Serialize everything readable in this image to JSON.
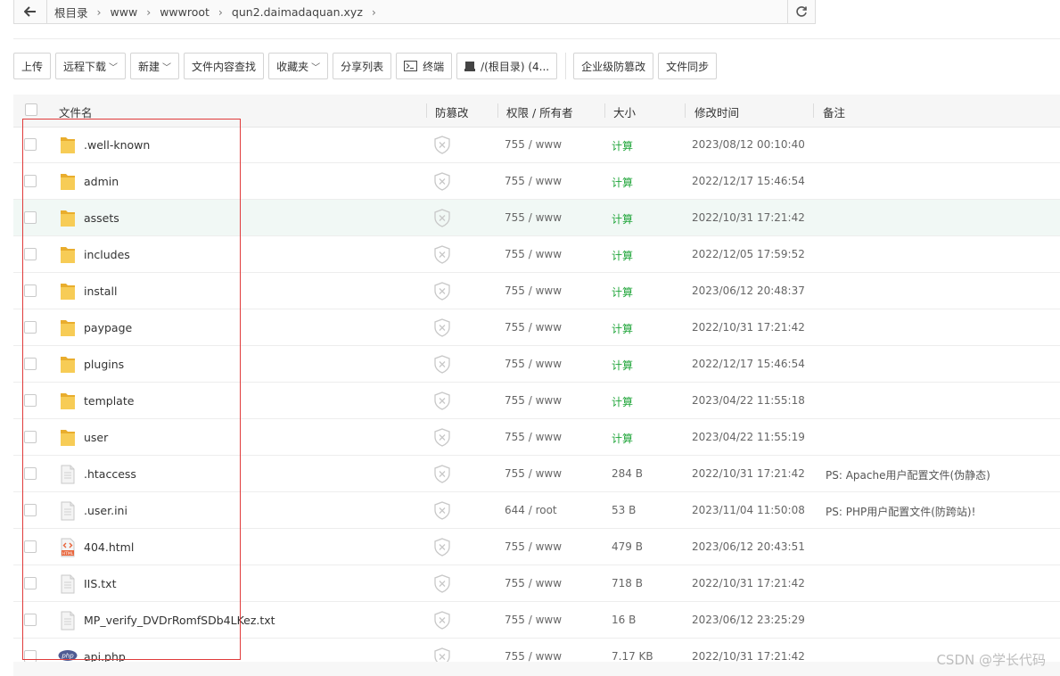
{
  "address": {
    "crumbs": [
      "根目录",
      "www",
      "wwwroot",
      "qun2.daimadaquan.xyz"
    ],
    "back_icon": "arrow-left-icon",
    "refresh_icon": "refresh-icon"
  },
  "toolbar": {
    "upload": "上传",
    "remote_download": "远程下载",
    "new": "新建",
    "content_search": "文件内容查找",
    "favorites": "收藏夹",
    "share_list": "分享列表",
    "terminal": "终端",
    "disk": "/(根目录) (4...",
    "enterprise_tamper": "企业级防篡改",
    "file_sync": "文件同步"
  },
  "table": {
    "headers": {
      "name": "文件名",
      "tamper": "防篡改",
      "perm": "权限 / 所有者",
      "size": "大小",
      "mtime": "修改时间",
      "note": "备注"
    },
    "rows": [
      {
        "name": ".well-known",
        "type": "folder",
        "perm": "755 / www",
        "size": "计算",
        "mtime": "2023/08/12 00:10:40",
        "note": ""
      },
      {
        "name": "admin",
        "type": "folder",
        "perm": "755 / www",
        "size": "计算",
        "mtime": "2022/12/17 15:46:54",
        "note": ""
      },
      {
        "name": "assets",
        "type": "folder",
        "perm": "755 / www",
        "size": "计算",
        "mtime": "2022/10/31 17:21:42",
        "note": ""
      },
      {
        "name": "includes",
        "type": "folder",
        "perm": "755 / www",
        "size": "计算",
        "mtime": "2022/12/05 17:59:52",
        "note": ""
      },
      {
        "name": "install",
        "type": "folder",
        "perm": "755 / www",
        "size": "计算",
        "mtime": "2023/06/12 20:48:37",
        "note": ""
      },
      {
        "name": "paypage",
        "type": "folder",
        "perm": "755 / www",
        "size": "计算",
        "mtime": "2022/10/31 17:21:42",
        "note": ""
      },
      {
        "name": "plugins",
        "type": "folder",
        "perm": "755 / www",
        "size": "计算",
        "mtime": "2022/12/17 15:46:54",
        "note": ""
      },
      {
        "name": "template",
        "type": "folder",
        "perm": "755 / www",
        "size": "计算",
        "mtime": "2023/04/22 11:55:18",
        "note": ""
      },
      {
        "name": "user",
        "type": "folder",
        "perm": "755 / www",
        "size": "计算",
        "mtime": "2023/04/22 11:55:19",
        "note": ""
      },
      {
        "name": ".htaccess",
        "type": "file",
        "perm": "755 / www",
        "size": "284 B",
        "mtime": "2022/10/31 17:21:42",
        "note": "PS: Apache用户配置文件(伪静态)"
      },
      {
        "name": ".user.ini",
        "type": "file",
        "perm": "644 / root",
        "size": "53 B",
        "mtime": "2023/11/04 11:50:08",
        "note": "PS: PHP用户配置文件(防跨站)!"
      },
      {
        "name": "404.html",
        "type": "html",
        "perm": "755 / www",
        "size": "479 B",
        "mtime": "2023/06/12 20:43:51",
        "note": ""
      },
      {
        "name": "IIS.txt",
        "type": "file",
        "perm": "755 / www",
        "size": "718 B",
        "mtime": "2022/10/31 17:21:42",
        "note": ""
      },
      {
        "name": "MP_verify_DVDrRomfSDb4LKez.txt",
        "type": "file",
        "perm": "755 / www",
        "size": "16 B",
        "mtime": "2023/06/12 23:25:29",
        "note": ""
      },
      {
        "name": "api.php",
        "type": "php",
        "perm": "755 / www",
        "size": "7.17 KB",
        "mtime": "2022/10/31 17:21:42",
        "note": ""
      }
    ]
  },
  "colors": {
    "accent_green": "#20a53a",
    "highlight_row": "#f1f8f5",
    "annotation_red": "#e03b3b",
    "folder": "#f5c244"
  },
  "watermark": "CSDN @学长代码"
}
